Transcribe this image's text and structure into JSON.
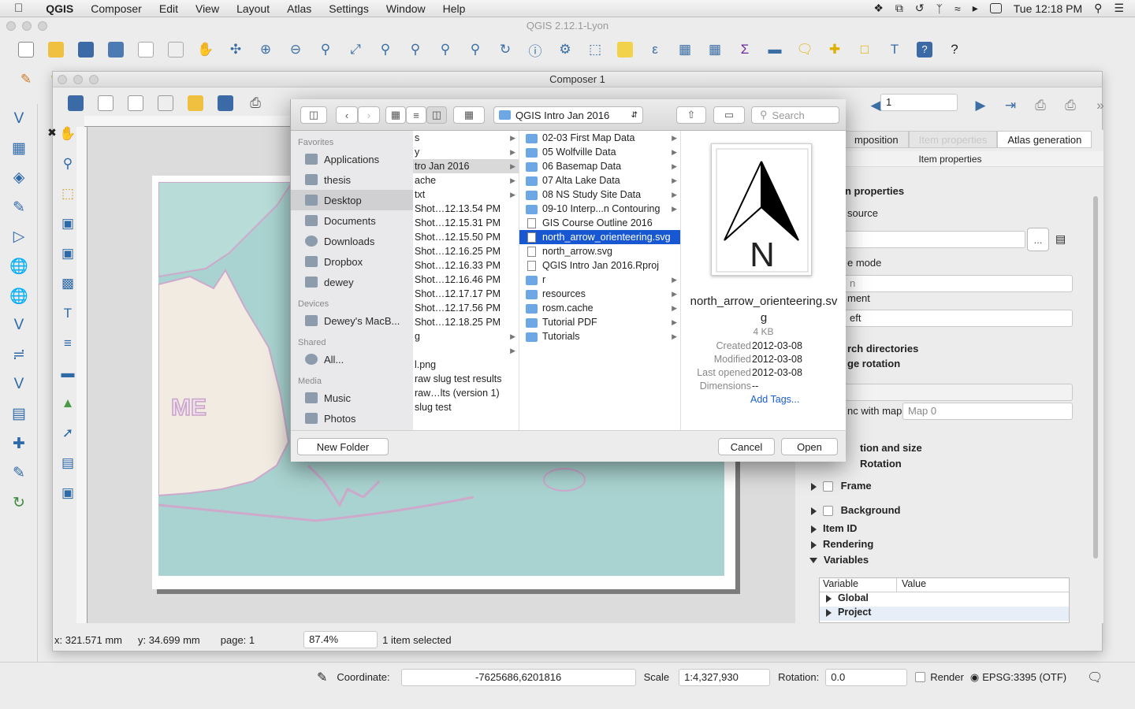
{
  "menubar": {
    "app": "QGIS",
    "items": [
      "Composer",
      "Edit",
      "View",
      "Layout",
      "Atlas",
      "Settings",
      "Window",
      "Help"
    ],
    "clock": "Tue 12:18 PM"
  },
  "qgis": {
    "title": "QGIS 2.12.1-Lyon"
  },
  "composer": {
    "title": "Composer 1",
    "page_field": "1",
    "tabs": [
      "mposition",
      "Item properties",
      "Atlas generation"
    ],
    "panel_title": "Item properties",
    "map_label": "ME",
    "status": {
      "x": "x: 321.571 mm",
      "y": "y: 34.699 mm",
      "page": "page: 1",
      "zoom": "87.4%",
      "selection": "1 item selected"
    },
    "props": {
      "heading": "n properties",
      "source_label": "source",
      "browse_label": "...",
      "mode_label": "e mode",
      "mode_value": "n",
      "placement_label": "ment",
      "placement_value": "eft",
      "search_dirs": "rch directories",
      "image_rotation": "ge rotation",
      "sync_label": "nc with map",
      "sync_value": "Map 0",
      "position_size": "tion and size",
      "rotation": "Rotation",
      "frame": "Frame",
      "background": "Background",
      "item_id": "Item ID",
      "rendering": "Rendering",
      "variables": "Variables",
      "var_col": "Variable",
      "value_col": "Value",
      "global": "Global",
      "project": "Project"
    }
  },
  "dialog": {
    "path": "QGIS Intro Jan 2016",
    "search_placeholder": "Search",
    "sidebar": {
      "favorites": "Favorites",
      "fav_items": [
        "Applications",
        "thesis",
        "Desktop",
        "Documents",
        "Downloads",
        "Dropbox",
        "dewey"
      ],
      "devices": "Devices",
      "device_items": [
        "Dewey's MacB..."
      ],
      "shared": "Shared",
      "shared_items": [
        "All..."
      ],
      "media": "Media",
      "media_items": [
        "Music",
        "Photos"
      ]
    },
    "col1": [
      "s",
      "y",
      "tro Jan 2016",
      "ache",
      "txt",
      "Shot…12.13.54 PM",
      "Shot…12.15.31 PM",
      "Shot…12.15.50 PM",
      "Shot…12.16.25 PM",
      "Shot…12.16.33 PM",
      "Shot…12.16.46 PM",
      "Shot…12.17.17 PM",
      "Shot…12.17.56 PM",
      "Shot…12.18.25 PM",
      "g",
      "",
      "l.png",
      "raw slug test results",
      "raw…lts (version 1)",
      "slug test"
    ],
    "col2": [
      {
        "name": "02-03 First Map Data",
        "kind": "folder"
      },
      {
        "name": "05 Wolfville Data",
        "kind": "folder"
      },
      {
        "name": "06 Basemap Data",
        "kind": "folder"
      },
      {
        "name": "07 Alta Lake Data",
        "kind": "folder"
      },
      {
        "name": "08 NS Study Site Data",
        "kind": "folder"
      },
      {
        "name": "09-10 Interp...n Contouring",
        "kind": "folder"
      },
      {
        "name": "GIS Course Outline 2016",
        "kind": "doc"
      },
      {
        "name": "north_arrow_orienteering.svg",
        "kind": "doc"
      },
      {
        "name": "north_arrow.svg",
        "kind": "doc"
      },
      {
        "name": "QGIS Intro Jan 2016.Rproj",
        "kind": "doc"
      },
      {
        "name": "r",
        "kind": "folder"
      },
      {
        "name": "resources",
        "kind": "folder"
      },
      {
        "name": "rosm.cache",
        "kind": "folder"
      },
      {
        "name": "Tutorial PDF",
        "kind": "folder"
      },
      {
        "name": "Tutorials",
        "kind": "folder"
      }
    ],
    "preview": {
      "filename": "north_arrow_orienteering.svg",
      "size": "4 KB",
      "glyph": "N",
      "created_label": "Created",
      "created": "2012-03-08",
      "modified_label": "Modified",
      "modified": "2012-03-08",
      "opened_label": "Last opened",
      "opened": "2012-03-08",
      "dimensions_label": "Dimensions",
      "dimensions": "--",
      "add_tags": "Add Tags..."
    },
    "new_folder": "New Folder",
    "cancel": "Cancel",
    "open": "Open"
  },
  "statusbar": {
    "coordinate_label": "Coordinate:",
    "coordinate": "-7625686,6201816",
    "scale_label": "Scale",
    "scale": "1:4,327,930",
    "rotation_label": "Rotation:",
    "rotation": "0.0",
    "render": "Render",
    "crs": "EPSG:3395 (OTF)"
  },
  "colors": {
    "selection": "#1857d2",
    "water": "#a9d3d0",
    "land": "#f2ebe2"
  }
}
